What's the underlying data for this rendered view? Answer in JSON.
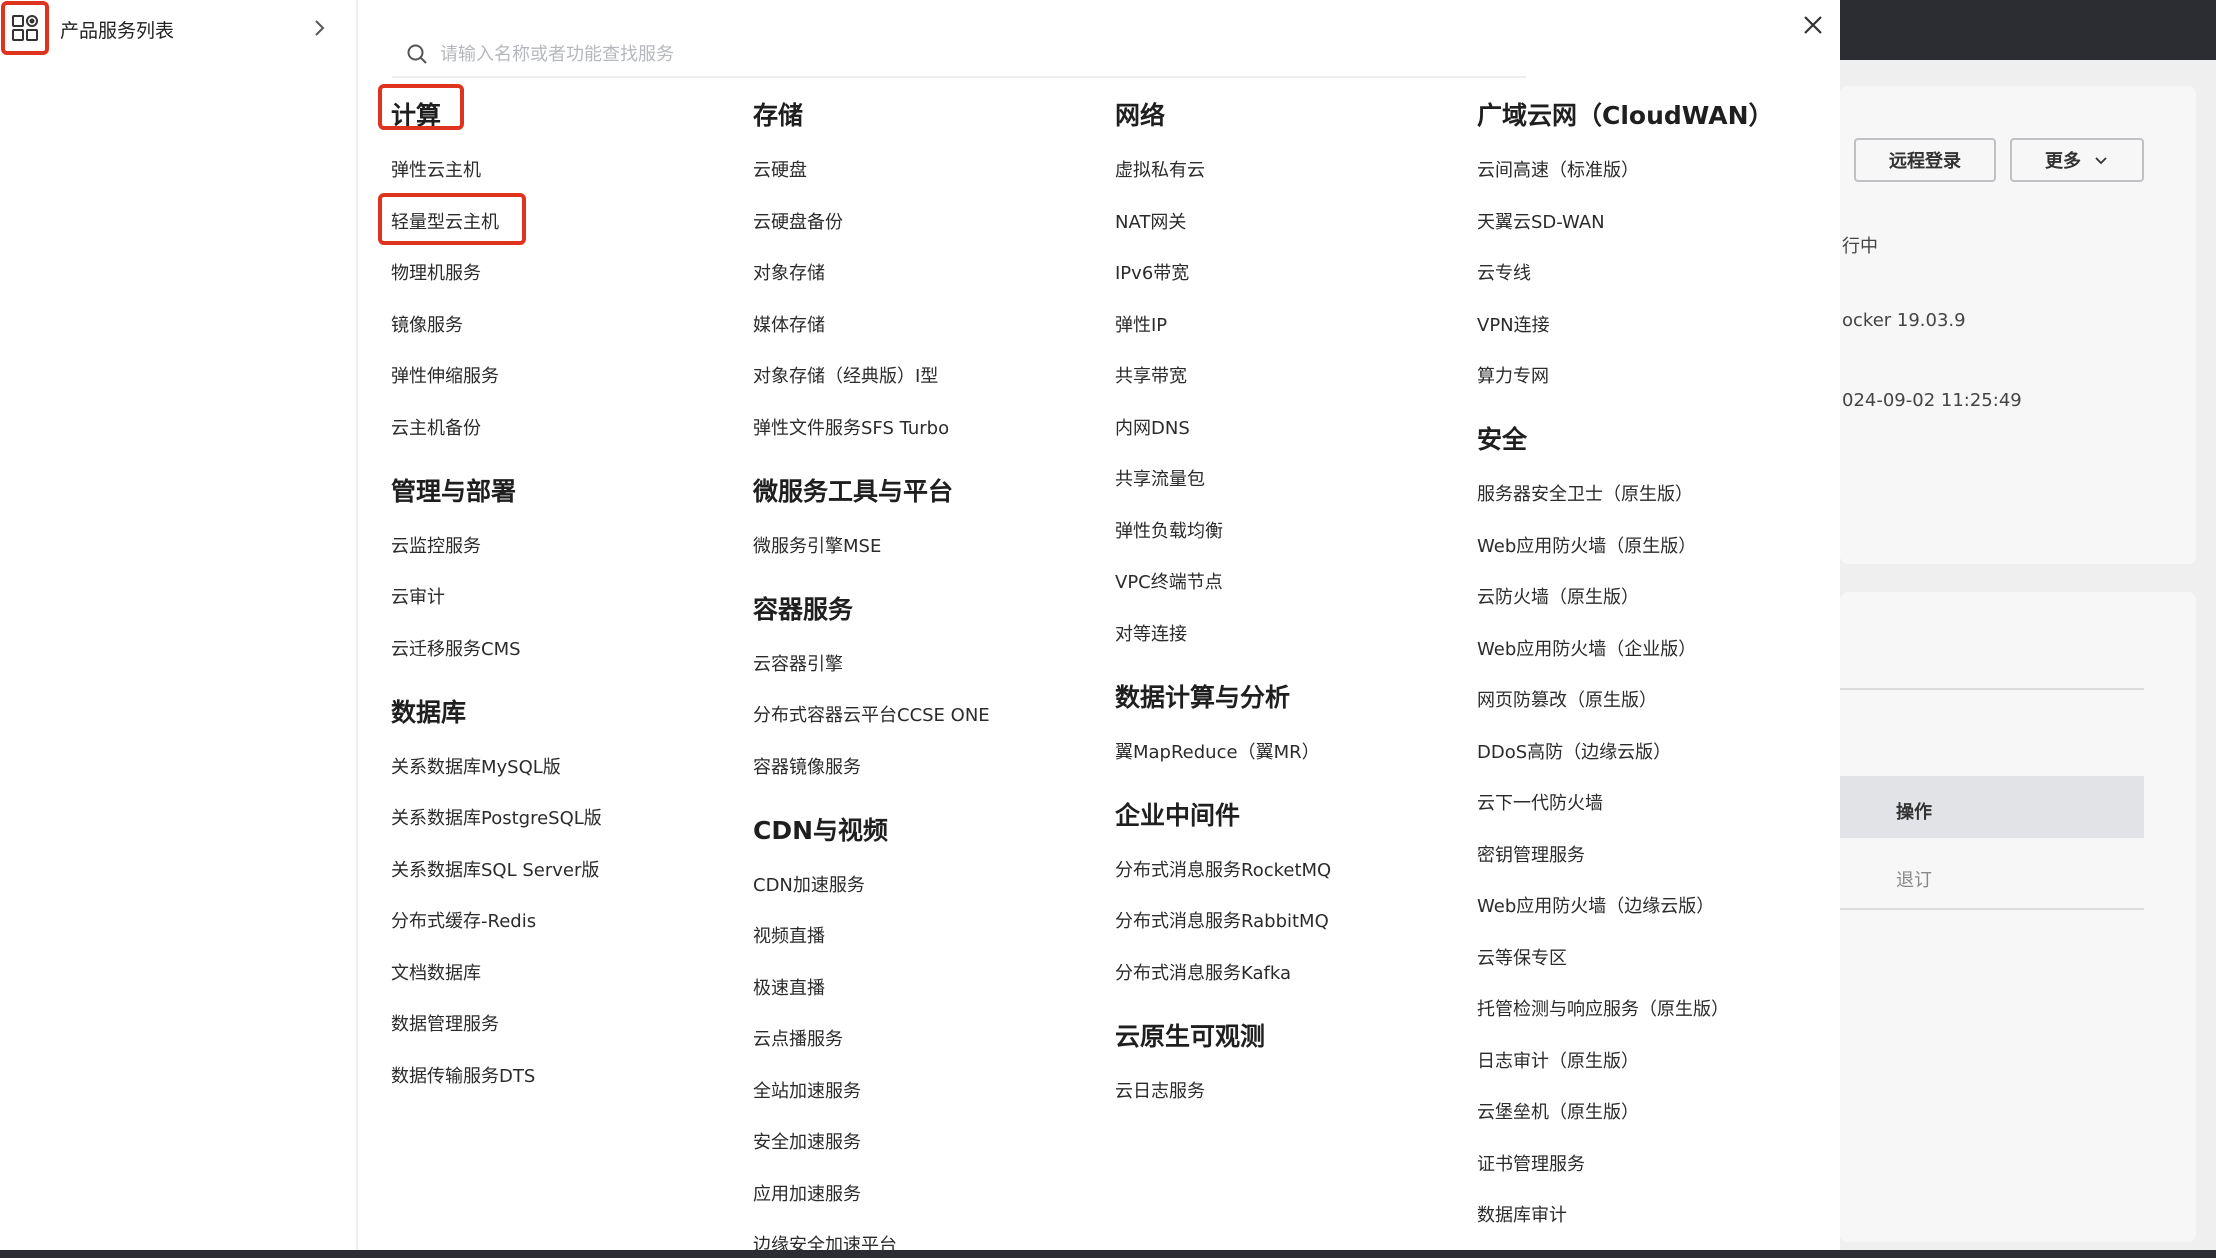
{
  "sidebar": {
    "product_list_label": "产品服务列表",
    "icon": "grid-icon"
  },
  "search": {
    "placeholder": "请输入名称或者功能查找服务"
  },
  "columns": [
    {
      "categories": [
        {
          "title": "计算",
          "items": [
            "弹性云主机",
            "轻量型云主机",
            "物理机服务",
            "镜像服务",
            "弹性伸缩服务",
            "云主机备份"
          ]
        },
        {
          "title": "管理与部署",
          "items": [
            "云监控服务",
            "云审计",
            "云迁移服务CMS"
          ]
        },
        {
          "title": "数据库",
          "items": [
            "关系数据库MySQL版",
            "关系数据库PostgreSQL版",
            "关系数据库SQL Server版",
            "分布式缓存-Redis",
            "文档数据库",
            "数据管理服务",
            "数据传输服务DTS"
          ]
        }
      ]
    },
    {
      "categories": [
        {
          "title": "存储",
          "items": [
            "云硬盘",
            "云硬盘备份",
            "对象存储",
            "媒体存储",
            "对象存储（经典版）I型",
            "弹性文件服务SFS Turbo"
          ]
        },
        {
          "title": "微服务工具与平台",
          "items": [
            "微服务引擎MSE"
          ]
        },
        {
          "title": "容器服务",
          "items": [
            "云容器引擎",
            "分布式容器云平台CCSE ONE",
            "容器镜像服务"
          ]
        },
        {
          "title": "CDN与视频",
          "items": [
            "CDN加速服务",
            "视频直播",
            "极速直播",
            "云点播服务",
            "全站加速服务",
            "安全加速服务",
            "应用加速服务",
            "边缘安全加速平台"
          ]
        }
      ]
    },
    {
      "categories": [
        {
          "title": "网络",
          "items": [
            "虚拟私有云",
            "NAT网关",
            "IPv6带宽",
            "弹性IP",
            "共享带宽",
            "内网DNS",
            "共享流量包",
            "弹性负载均衡",
            "VPC终端节点",
            "对等连接"
          ]
        },
        {
          "title": "数据计算与分析",
          "items": [
            "翼MapReduce（翼MR）"
          ]
        },
        {
          "title": "企业中间件",
          "items": [
            "分布式消息服务RocketMQ",
            "分布式消息服务RabbitMQ",
            "分布式消息服务Kafka"
          ]
        },
        {
          "title": "云原生可观测",
          "items": [
            "云日志服务"
          ]
        }
      ]
    },
    {
      "categories": [
        {
          "title": "广域云网（CloudWAN）",
          "items": [
            "云间高速（标准版）",
            "天翼云SD-WAN",
            "云专线",
            "VPN连接",
            "算力专网"
          ]
        },
        {
          "title": "安全",
          "items": [
            "服务器安全卫士（原生版）",
            "Web应用防火墙（原生版）",
            "云防火墙（原生版）",
            "Web应用防火墙（企业版）",
            "网页防篡改（原生版）",
            "DDoS高防（边缘云版）",
            "云下一代防火墙",
            "密钥管理服务",
            "Web应用防火墙（边缘云版）",
            "云等保专区",
            "托管检测与响应服务（原生版）",
            "日志审计（原生版）",
            "云堡垒机（原生版）",
            "证书管理服务",
            "数据库审计"
          ]
        }
      ]
    }
  ],
  "background_page": {
    "remote_login": "远程登录",
    "more": "更多",
    "status_partial": "行中",
    "docker_partial": "ocker 19.03.9",
    "date_partial": "024-09-02 11:25:49",
    "table_header_ops": "操作",
    "table_cell_unsubscribe": "退订"
  },
  "colors": {
    "highlight": "#e0331e",
    "dark_bar": "#2b2d33"
  }
}
